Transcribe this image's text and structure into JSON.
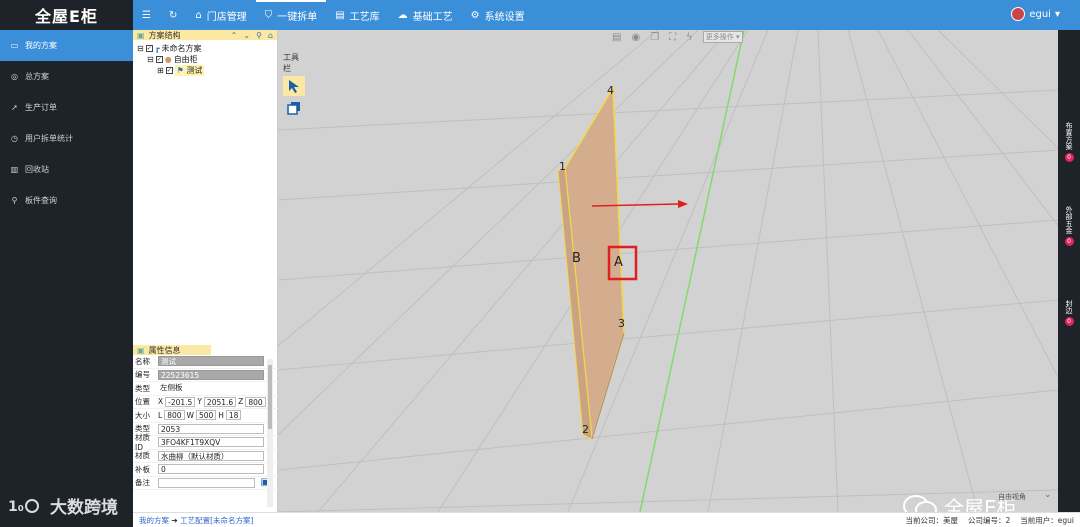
{
  "brand": {
    "logo_text": "全屋E柜"
  },
  "sidebar": {
    "items": [
      {
        "label": "我的方案",
        "icon": "folder-icon"
      },
      {
        "label": "总方案",
        "icon": "globe-icon"
      },
      {
        "label": "生产订单",
        "icon": "send-icon"
      },
      {
        "label": "用户拆单统计",
        "icon": "clock-icon"
      },
      {
        "label": "回收站",
        "icon": "trash-icon"
      },
      {
        "label": "板件查询",
        "icon": "search-icon"
      }
    ],
    "watermark": "大数跨境"
  },
  "topnav": {
    "items": [
      {
        "label": "门店管理",
        "icon": "home-icon"
      },
      {
        "label": "一键拆单",
        "icon": "shield-icon"
      },
      {
        "label": "工艺库",
        "icon": "book-icon"
      },
      {
        "label": "基础工艺",
        "icon": "cloud-icon"
      },
      {
        "label": "系统设置",
        "icon": "gear-icon"
      }
    ],
    "user": "egui"
  },
  "structure": {
    "title": "方案结构",
    "tree": [
      "未命名方案",
      "自由柜",
      "测试"
    ]
  },
  "properties": {
    "title": "属性信息",
    "name_label": "名称",
    "name": "测试",
    "code_label": "编号",
    "code": "22523615",
    "type_label": "类型",
    "type": "左侧板",
    "pos_label": "位置",
    "x": "-201.5",
    "y": "2051.6",
    "z": "800",
    "size_label": "大小",
    "l": "800",
    "w": "500",
    "h": "18",
    "kind_label": "类型",
    "kind": "2053",
    "matid_label": "材质ID",
    "matid": "3FO4KF1T9XQV",
    "mat_label": "材质",
    "mat": "水曲柳（默认材质）",
    "edge_label": "补板",
    "edge": "0",
    "note_label": "备注"
  },
  "viewport": {
    "toolbox_label": "工具栏",
    "more_label": "更多操作",
    "labels": [
      "1",
      "2",
      "3",
      "4",
      "A",
      "B"
    ],
    "view_label": "自由视角",
    "wechat_text": "全屋E柜"
  },
  "rightbar": {
    "groups": [
      {
        "label": "布置方案",
        "count": "0"
      },
      {
        "label": "外部五金",
        "count": "0"
      },
      {
        "label": "封边",
        "count": "0"
      }
    ]
  },
  "status": {
    "crumb_a": "我的方案",
    "crumb_b": "工艺配置[未命名方案]",
    "company": "当前公司：美屋",
    "code": "公司编号：2",
    "user": "当前用户：egui"
  },
  "colors": {
    "accent": "#3b8fd9",
    "sidebar": "#1e2329",
    "panel_highlight": "#fbe9a3",
    "badge": "#e0245e"
  }
}
